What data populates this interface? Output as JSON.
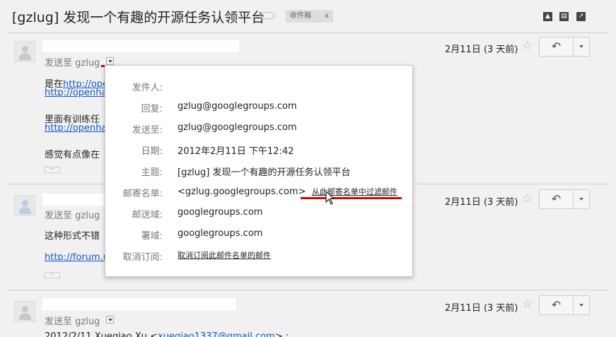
{
  "header": {
    "subject": "[gzlug] 发现一个有趣的开源任务认领平台",
    "label_chip": "收件箱",
    "label_remove": "x",
    "icons": [
      "expand-all-icon",
      "print-icon",
      "new-window-icon"
    ]
  },
  "messages": [
    {
      "sendto": "发送至 gzlug",
      "date": "2月11日 (3 天前)",
      "star": "☆",
      "lines": [
        "是在",
        "http://ope",
        "http://openha",
        "里面有训练任",
        "http://openha",
        "感觉有点像在"
      ],
      "ellipsis": "···"
    },
    {
      "sendto": "发送至 gzlug",
      "date": "2月11日 (3 天前)",
      "star": "☆",
      "lines": [
        "这种形式不错",
        "http://forum.u"
      ],
      "ellipsis": "···"
    },
    {
      "sendto": "发送至 gzlug",
      "date": "2月11日 (3 天前)",
      "star": "☆",
      "lines": [
        "2012/2/11 Xueqiao Xu",
        "xueqiao1337@gmail.com",
        " :"
      ]
    }
  ],
  "popup": {
    "rows": [
      {
        "label": "发件人:",
        "value": ""
      },
      {
        "label": "回复:",
        "value": "gzlug@googlegroups.com"
      },
      {
        "label": "发送至:",
        "value": "gzlug@googlegroups.com"
      },
      {
        "label": "日期:",
        "value": "2012年2月11日 下午12:42"
      },
      {
        "label": "主题:",
        "value": "[gzlug] 发现一个有趣的开源任务认领平台"
      },
      {
        "label": "邮寄名单:",
        "value": "<gzlug.googlegroups.com>",
        "link": "从此邮寄名单中过滤邮件"
      },
      {
        "label": "邮送域:",
        "value": "googlegroups.com"
      },
      {
        "label": "署域:",
        "value": "googlegroups.com"
      },
      {
        "label": "取消订阅:",
        "link": "取消订阅此邮件名单的邮件"
      }
    ]
  },
  "colors": {
    "link": "#1155cc",
    "annotation_red": "#dd0000",
    "background": "#f1f1f1"
  }
}
